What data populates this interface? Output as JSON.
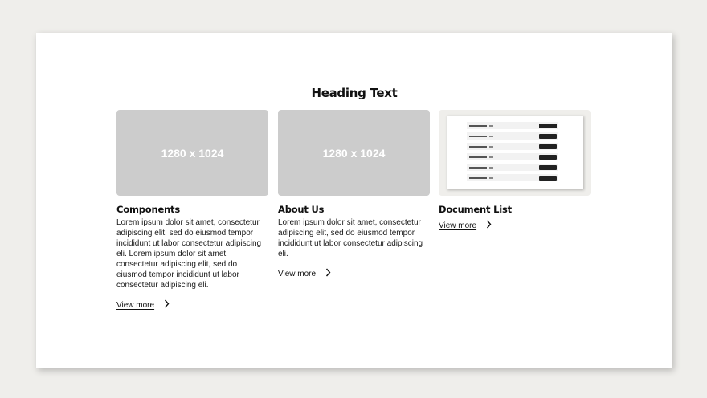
{
  "heading": "Heading Text",
  "cards": [
    {
      "placeholder": "1280 x 1024",
      "title": "Components",
      "text": "Lorem ipsum dolor sit amet, consectetur adipiscing elit, sed do eiusmod tempor incididunt ut labor consectetur adipiscing eli. Lorem ipsum dolor sit amet, consectetur adipiscing elit, sed do eiusmod tempor incididunt ut labor consectetur adipiscing eli.",
      "link": "View more"
    },
    {
      "placeholder": "1280 x 1024",
      "title": "About Us",
      "text": "Lorem ipsum dolor sit amet, consectetur adipiscing elit, sed do eiusmod tempor incididunt ut labor consectetur adipiscing eli.",
      "link": "View more"
    },
    {
      "title": "Document List",
      "link": "View more"
    }
  ],
  "icons": {
    "link_chevron": "chevron-right-icon"
  }
}
